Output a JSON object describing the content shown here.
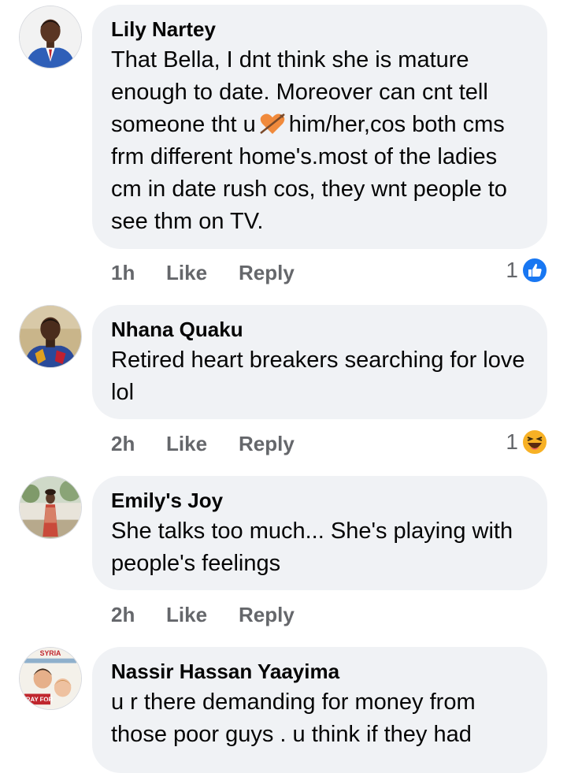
{
  "colors": {
    "bubble": "#f0f2f5",
    "meta": "#65676b",
    "like_blue": "#1877f2",
    "haha_yellow": "#f7b125"
  },
  "comments": [
    {
      "author": "Lily Nartey",
      "text_part1": "That Bella, I dnt think she is mature enough to date. Moreover can cnt tell someone tht u",
      "inline_icon": "heart-with-arrow-icon",
      "text_part2": "him/her,cos both cms frm different home's.most of the ladies cm in date rush cos, they wnt people to see thm on TV.",
      "time": "1h",
      "like_label": "Like",
      "reply_label": "Reply",
      "reaction_count": "1",
      "reaction_icon": "like-reaction-icon"
    },
    {
      "author": "Nhana Quaku",
      "text": "Retired heart breakers searching for love lol",
      "time": "2h",
      "like_label": "Like",
      "reply_label": "Reply",
      "reaction_count": "1",
      "reaction_icon": "haha-reaction-icon"
    },
    {
      "author": "Emily's Joy",
      "text": "She talks too much... She's playing with people's feelings",
      "time": "2h",
      "like_label": "Like",
      "reply_label": "Reply"
    },
    {
      "author": "Nassir Hassan Yaayima",
      "text": "u r there demanding for money from those poor guys . u think if they had",
      "avatar_text_top": "SYRIA",
      "avatar_text_bottom": "PRAY FOR"
    }
  ]
}
